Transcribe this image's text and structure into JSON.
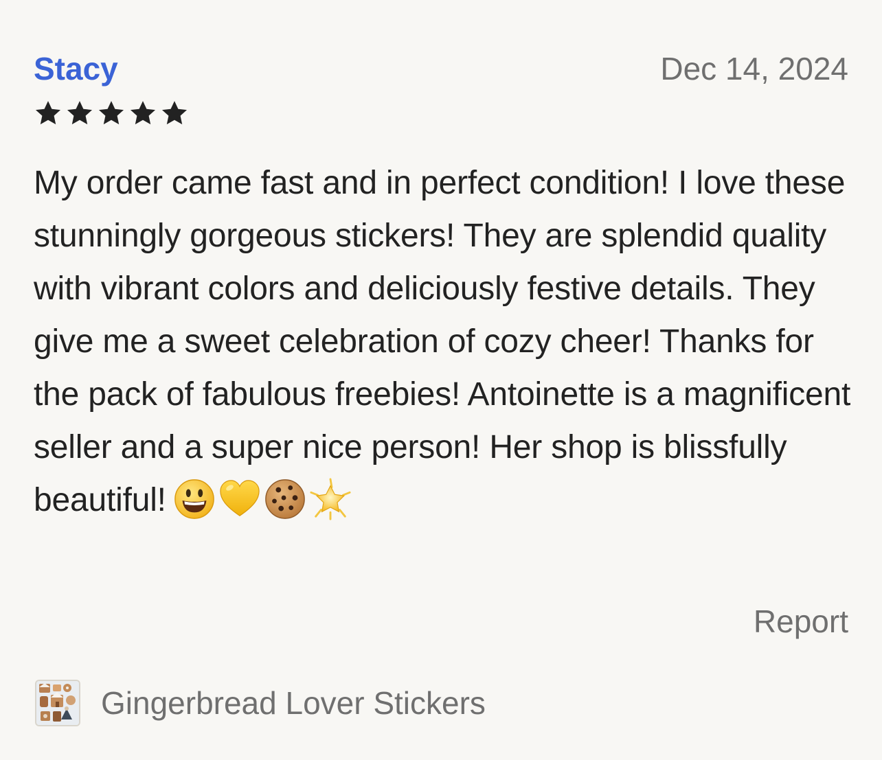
{
  "review": {
    "reviewer_name": "Stacy",
    "date": "Dec 14, 2024",
    "rating": 5,
    "rating_max": 5,
    "star_icon": "star-icon",
    "star_color": "#222222",
    "text": "My order came fast and in perfect condition! I love these stunningly gorgeous stickers! They are splendid quality with vibrant colors and deliciously festive details. They give me a sweet celebration of cozy cheer! Thanks for the pack of fabulous freebies! Antoinette is a magnificent seller and a super nice person! Her shop is blissfully beautiful!",
    "emojis": [
      "smiley-face-emoji",
      "yellow-heart-emoji",
      "cookie-emoji",
      "glowing-star-emoji"
    ],
    "report_label": "Report"
  },
  "listing": {
    "title": "Gingerbread Lover Stickers",
    "thumbnail": "sticker-sheet-thumbnail"
  },
  "colors": {
    "background": "#f8f7f4",
    "reviewer_name": "#3b63d6",
    "secondary_text": "#6f6f6f",
    "body_text": "#222222"
  }
}
